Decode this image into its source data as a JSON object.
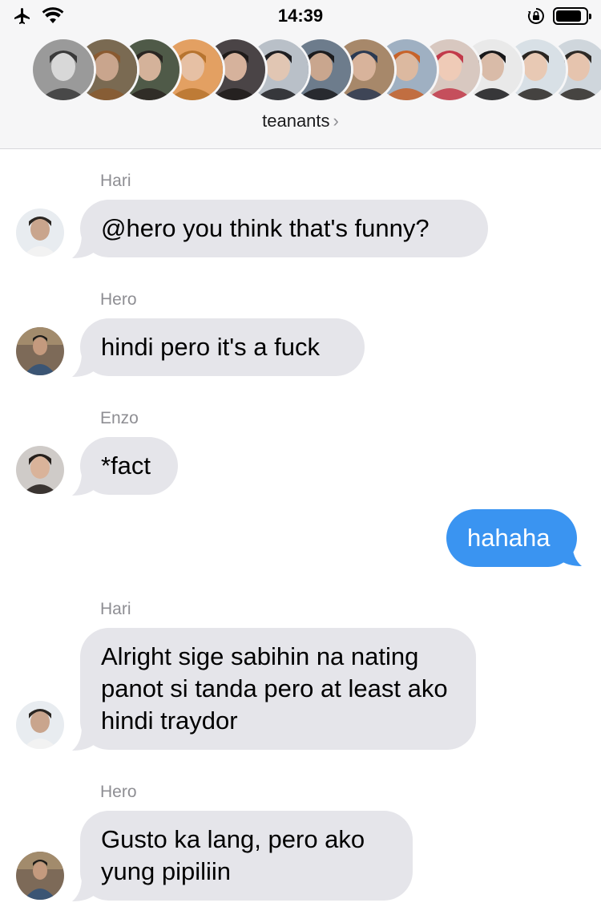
{
  "status_bar": {
    "time": "14:39",
    "airplane_icon": "airplane-icon",
    "wifi_icon": "wifi-icon",
    "orientation_lock_icon": "orientation-lock-icon",
    "battery_level": 0.85
  },
  "conversation": {
    "title": "teanants",
    "title_chevron": "›",
    "member_avatar_count": 13
  },
  "messages": [
    {
      "sender": "Hari",
      "text": "@hero you think that's funny?",
      "direction": "incoming"
    },
    {
      "sender": "Hero",
      "text": "hindi pero it's a fuck",
      "direction": "incoming"
    },
    {
      "sender": "Enzo",
      "text": "*fact",
      "direction": "incoming"
    },
    {
      "sender": "",
      "text": "hahaha",
      "direction": "outgoing"
    },
    {
      "sender": "Hari",
      "text": "Alright sige sabihin na nating panot si tanda pero at least ako hindi traydor",
      "direction": "incoming"
    },
    {
      "sender": "Hero",
      "text": "Gusto ka lang, pero ako yung pipiliin",
      "direction": "incoming"
    }
  ],
  "colors": {
    "incoming_bubble": "#e5e5ea",
    "outgoing_bubble": "#3a94f1",
    "header_bg": "#f6f6f7",
    "sender_label": "#8e8e93"
  }
}
